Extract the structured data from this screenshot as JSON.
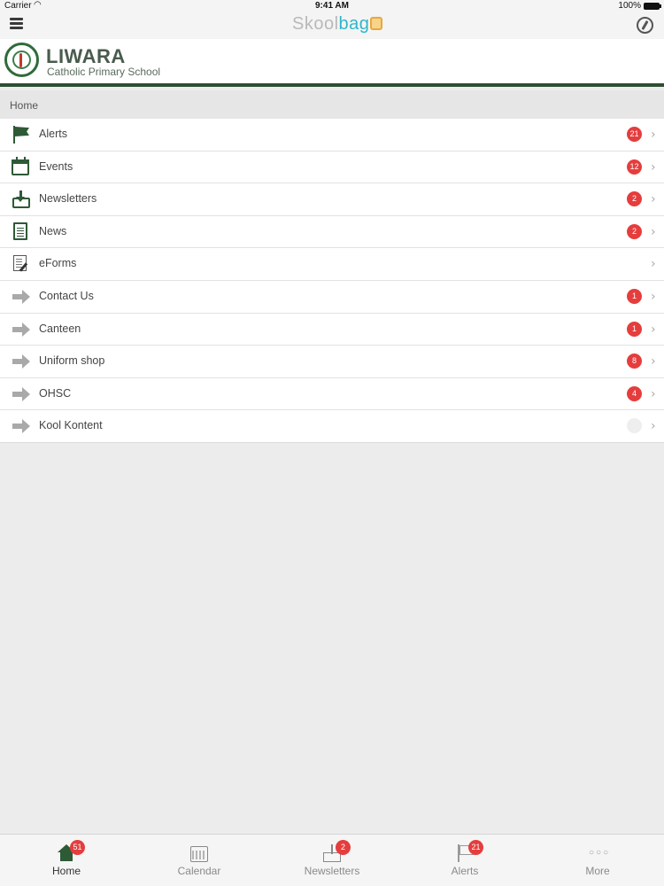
{
  "status_bar": {
    "carrier": "Carrier",
    "time": "9:41 AM",
    "battery": "100%"
  },
  "nav": {
    "brand_skool": "Skool",
    "brand_bag": "bag"
  },
  "school": {
    "name": "LIWARA",
    "subtitle": "Catholic Primary School"
  },
  "breadcrumb": "Home",
  "menu": [
    {
      "label": "Alerts",
      "badge": "21",
      "icon": "flag-icon"
    },
    {
      "label": "Events",
      "badge": "12",
      "icon": "calendar-icon"
    },
    {
      "label": "Newsletters",
      "badge": "2",
      "icon": "inbox-download-icon"
    },
    {
      "label": "News",
      "badge": "2",
      "icon": "document-icon"
    },
    {
      "label": "eForms",
      "badge": "",
      "icon": "form-edit-icon"
    },
    {
      "label": "Contact Us",
      "badge": "1",
      "icon": "arrow-right-icon"
    },
    {
      "label": "Canteen",
      "badge": "1",
      "icon": "arrow-right-icon"
    },
    {
      "label": "Uniform shop",
      "badge": "8",
      "icon": "arrow-right-icon"
    },
    {
      "label": "OHSC",
      "badge": "4",
      "icon": "arrow-right-icon"
    },
    {
      "label": "Kool Kontent",
      "badge": "",
      "icon": "arrow-right-icon"
    }
  ],
  "tabs": [
    {
      "label": "Home",
      "badge": "51",
      "icon": "home-icon"
    },
    {
      "label": "Calendar",
      "badge": "",
      "icon": "calendar-icon"
    },
    {
      "label": "Newsletters",
      "badge": "2",
      "icon": "inbox-download-icon"
    },
    {
      "label": "Alerts",
      "badge": "21",
      "icon": "flag-icon"
    },
    {
      "label": "More",
      "badge": "",
      "icon": "more-dots-icon"
    }
  ],
  "colors": {
    "accent_green": "#2e5a36",
    "badge_red": "#e53d3d",
    "brand_blue": "#2eb6c9"
  }
}
